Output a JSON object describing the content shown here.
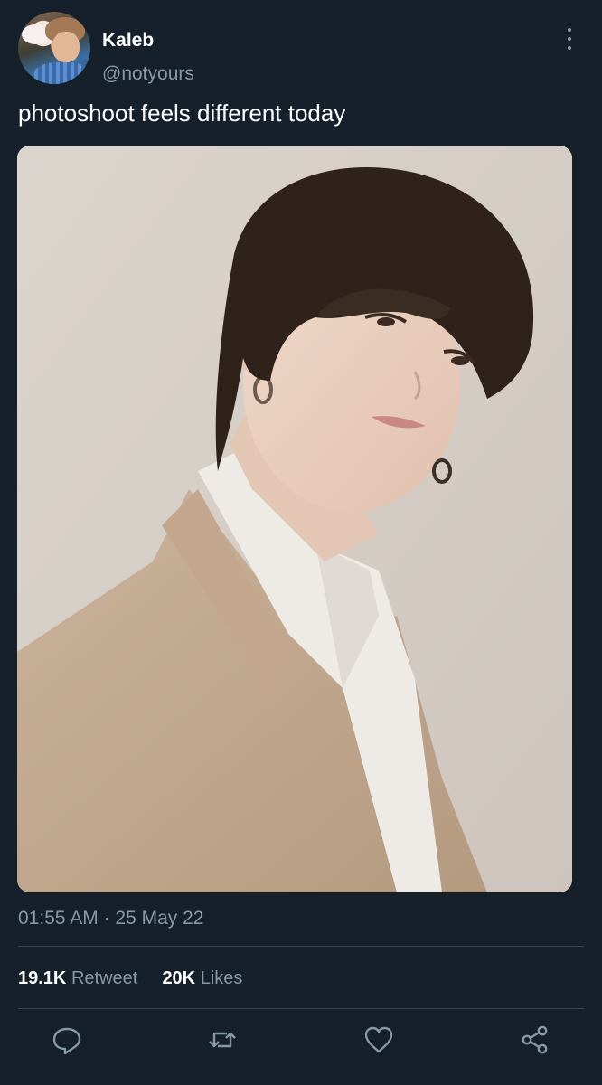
{
  "author": {
    "name": "Kaleb",
    "handle": "@notyours",
    "avatar_icon": "profile-photo"
  },
  "tweet": {
    "text": "photoshoot feels different today",
    "image_icon": "photo",
    "timestamp": "01:55 AM · 25 May 22"
  },
  "stats": {
    "retweets_count": "19.1K",
    "retweets_label": "Retweet",
    "likes_count": "20K",
    "likes_label": "Likes"
  },
  "actions": [
    "reply-icon",
    "retweet-icon",
    "like-icon",
    "share-icon"
  ],
  "colors": {
    "background": "#15202b",
    "secondary_text": "#8899a6",
    "divider": "#38444d",
    "primary_text": "#ffffff"
  }
}
